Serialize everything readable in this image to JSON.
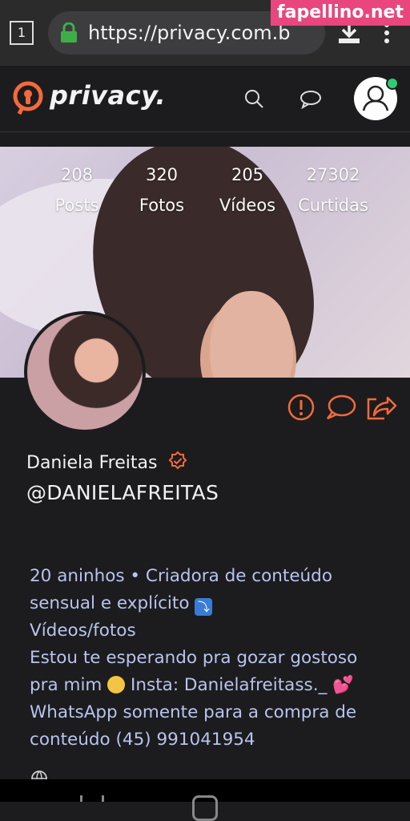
{
  "browser": {
    "tab_count": "1",
    "url": "https://privacy.com.b"
  },
  "watermark": "fapellino.net",
  "app": {
    "logo_text": "privacy.",
    "accent_color": "#f26a3d",
    "icons": [
      "search-icon",
      "chat-icon",
      "user-icon"
    ]
  },
  "profile": {
    "stats": [
      {
        "value": "208",
        "label": "Posts"
      },
      {
        "value": "320",
        "label": "Fotos"
      },
      {
        "value": "205",
        "label": "Vídeos"
      },
      {
        "value": "27302",
        "label": "Curtidas"
      }
    ],
    "name": "Daniela Freitas",
    "handle": "@DANIELAFREITAS",
    "bio": {
      "line1": "20 aninhos • Criadora de conteúdo",
      "line2": "sensual e explícito",
      "emoji_down": "⤵",
      "line3": "Vídeos/fotos",
      "line4": "Estou te esperando pra gozar gostoso",
      "line5a": "pra mim",
      "line5b": "Insta: Danielafreitass._",
      "heart": "💕",
      "line6": "WhatsApp somente para a compra de",
      "line7": "conteúdo (45) 991041954"
    },
    "actions": [
      "report-icon",
      "message-icon",
      "share-icon"
    ]
  }
}
